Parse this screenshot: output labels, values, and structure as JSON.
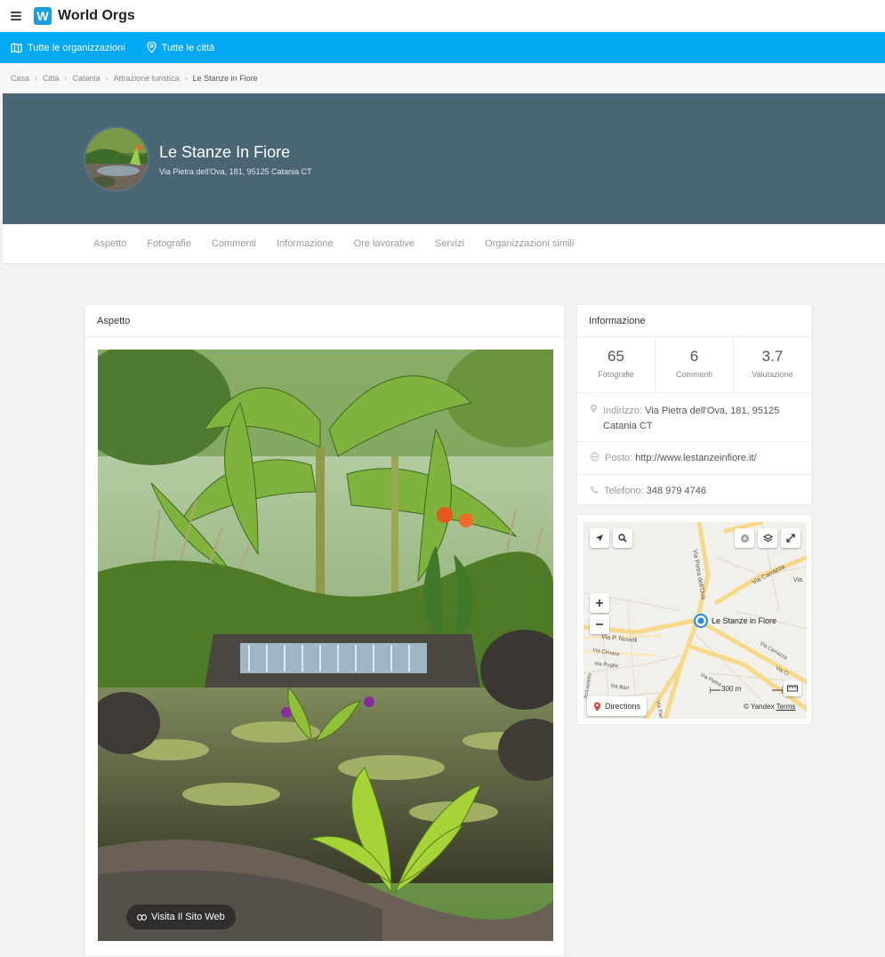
{
  "header": {
    "logo_letter": "W",
    "brand": "World Orgs"
  },
  "bluebar": {
    "orgs": "Tutte le organizzazioni",
    "cities": "Tutte le città"
  },
  "breadcrumb": [
    "Casa",
    "Città",
    "Catania",
    "Attrazione turistica",
    "Le Stanze in Fiore"
  ],
  "hero": {
    "title": "Le Stanze In Fiore",
    "address": "Via Pietra dell'Ova, 181, 95125 Catania CT"
  },
  "tabs": [
    "Aspetto",
    "Fotografie",
    "Commenti",
    "Informazione",
    "Ore lavorative",
    "Servizi",
    "Organizzazioni simili"
  ],
  "aspetto": {
    "title": "Aspetto",
    "visit_label": "Visita Il Sito Web"
  },
  "info": {
    "title": "Informazione",
    "stats": [
      {
        "num": "65",
        "label": "Fotografie"
      },
      {
        "num": "6",
        "label": "Commenti"
      },
      {
        "num": "3.7",
        "label": "Valutazione"
      }
    ],
    "address_label": "Indirizzo:",
    "address_value": "Via Pietra dell'Ova, 181, 95125 Catania CT",
    "site_label": "Posto:",
    "site_value": "http://www.lestanzeinfiore.it/",
    "phone_label": "Telefono:",
    "phone_value": "348 979 4746"
  },
  "map": {
    "place": "Le Stanze in Fiore",
    "streets": [
      "Via Pietra dell'Ova",
      "Via Carrazza",
      "Via",
      "Via P. Novelli",
      "Via Cimone",
      "Via Puglia",
      "Via Carrazza",
      "Via Ci",
      "Via Pietra",
      "Via Bari",
      "Via Pietra dell'Ova",
      "Acicastello"
    ],
    "scale": "300 m",
    "directions": "Directions",
    "attribution": "© Yandex",
    "terms": "Terms"
  },
  "colors": {
    "accent": "#03a9f4",
    "hero_bg": "#4a6573",
    "brand": "#1a9ed9"
  }
}
